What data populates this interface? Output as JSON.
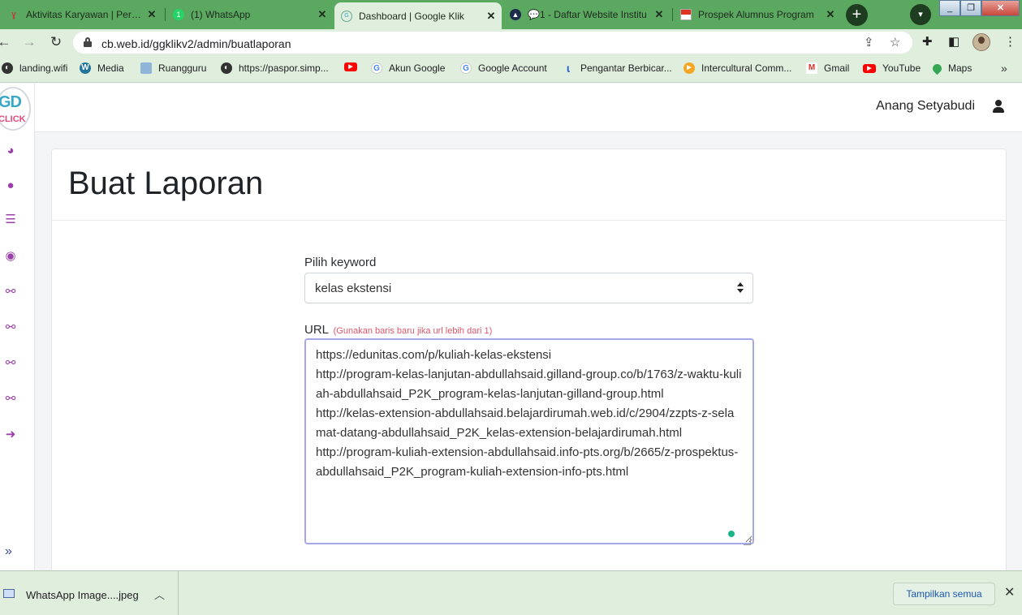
{
  "tabs": [
    {
      "title": "Aktivitas Karyawan | Person",
      "favicon": "ai-icon"
    },
    {
      "title": "(1) WhatsApp",
      "favicon": "whatsapp-icon"
    },
    {
      "title": "Dashboard | Google Klik",
      "favicon": "google-klik-icon"
    },
    {
      "title": "💬1 - Daftar Website Institu",
      "favicon": "grad-cap-icon"
    },
    {
      "title": "Prospek Alumnus Program",
      "favicon": "flag-icon"
    }
  ],
  "address": {
    "url": "cb.web.id/ggklikv2/admin/buatlaporan"
  },
  "bookmarks": [
    {
      "label": "landing.wifi",
      "icon": "globe-icon"
    },
    {
      "label": "Media",
      "icon": "wordpress-icon"
    },
    {
      "label": "Ruangguru",
      "icon": "ruangguru-icon"
    },
    {
      "label": "https://paspor.simp...",
      "icon": "globe-icon"
    },
    {
      "label": "",
      "icon": "youtube-icon"
    },
    {
      "label": "Akun Google",
      "icon": "google-icon"
    },
    {
      "label": "Google Account",
      "icon": "google-icon"
    },
    {
      "label": "Pengantar Berbicar...",
      "icon": "bookmark-icon"
    },
    {
      "label": "Intercultural Comm...",
      "icon": "play-icon"
    },
    {
      "label": "Gmail",
      "icon": "gmail-icon"
    },
    {
      "label": "YouTube",
      "icon": "youtube-icon"
    },
    {
      "label": "Maps",
      "icon": "maps-icon"
    }
  ],
  "colors": {
    "accent": "#9b3fa9",
    "tab_bg": "#5ba860",
    "toolbar_bg": "#dfeedd",
    "hint": "#e0566a"
  },
  "header": {
    "username": "Anang Setyabudi"
  },
  "page": {
    "title": "Buat Laporan"
  },
  "form": {
    "keyword_label": "Pilih keyword",
    "keyword_value": "kelas ekstensi",
    "url_label": "URL",
    "url_hint": "(Gunakan baris baru jika url lebih dari 1)",
    "url_value": "https://edunitas.com/p/kuliah-kelas-ekstensi\nhttp://program-kelas-lanjutan-abdullahsaid.gilland-group.co/b/1763/z-waktu-kuliah-abdullahsaid_P2K_program-kelas-lanjutan-gilland-group.html\nhttp://kelas-extension-abdullahsaid.belajardirumah.web.id/c/2904/zzpts-z-selamat-datang-abdullahsaid_P2K_kelas-extension-belajardirumah.html\nhttp://program-kuliah-extension-abdullahsaid.info-pts.org/b/2665/z-prospektus-abdullahsaid_P2K_program-kuliah-extension-info-pts.html"
  },
  "downloads": {
    "file": "WhatsApp Image....jpeg",
    "show_all": "Tampilkan semua"
  }
}
